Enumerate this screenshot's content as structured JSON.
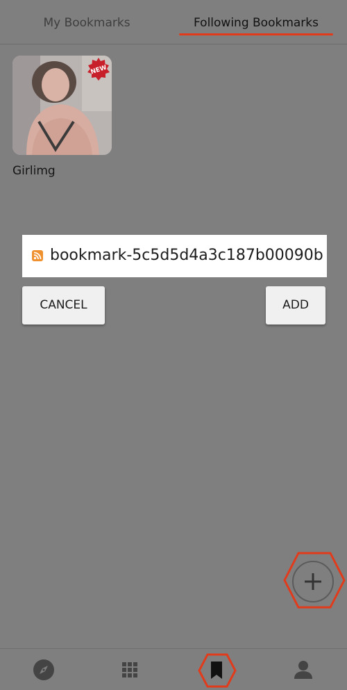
{
  "tabs": {
    "my_bookmarks": "My Bookmarks",
    "following_bookmarks": "Following Bookmarks",
    "active": "following_bookmarks"
  },
  "following": {
    "items": [
      {
        "label": "Girlimg",
        "badge": "NEW"
      }
    ]
  },
  "dialog": {
    "input_value": "bookmark-5c5d5d4a3c187b00090b",
    "icon": "rss-icon",
    "cancel_label": "CANCEL",
    "add_label": "ADD"
  },
  "fab": {
    "icon": "plus-icon",
    "highlight_color": "#e23b1b"
  },
  "bottom_nav": {
    "items": [
      {
        "icon": "compass-icon",
        "name": "explore"
      },
      {
        "icon": "grid-icon",
        "name": "apps"
      },
      {
        "icon": "bookmark-icon",
        "name": "bookmarks",
        "active": true
      },
      {
        "icon": "person-icon",
        "name": "profile"
      }
    ]
  },
  "colors": {
    "overlay_bg": "#7f7f7f",
    "accent": "#e23b1b",
    "badge": "#c8202a",
    "rss": "#f0912f"
  }
}
